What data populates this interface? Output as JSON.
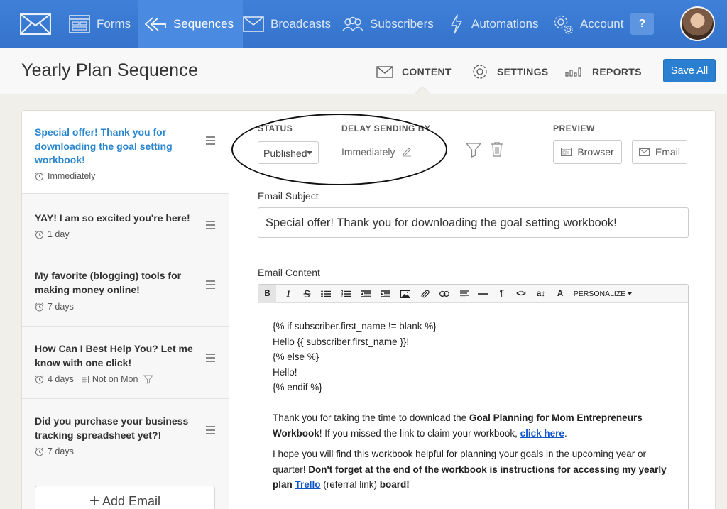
{
  "nav": {
    "items": [
      {
        "label": "Forms",
        "icon": "form-icon"
      },
      {
        "label": "Sequences",
        "icon": "sequence-arrows-icon"
      },
      {
        "label": "Broadcasts",
        "icon": "envelope-icon"
      },
      {
        "label": "Subscribers",
        "icon": "people-icon"
      },
      {
        "label": "Automations",
        "icon": "lightning-icon"
      },
      {
        "label": "Account",
        "icon": "gear-icon"
      }
    ],
    "active": "Sequences",
    "help_label": "?"
  },
  "header": {
    "title": "Yearly Plan Sequence",
    "tabs": [
      {
        "label": "CONTENT",
        "icon": "envelope-icon"
      },
      {
        "label": "SETTINGS",
        "icon": "gear-icon"
      },
      {
        "label": "REPORTS",
        "icon": "bar-chart-icon"
      }
    ],
    "active_tab": "CONTENT",
    "save_label": "Save All"
  },
  "sidebar": {
    "emails": [
      {
        "title": "Special offer! Thank you for downloading the goal setting workbook!",
        "delay": "Immediately",
        "active": true
      },
      {
        "title": "YAY! I am so excited you're here!",
        "delay": "1 day"
      },
      {
        "title": "My favorite (blogging) tools for making money online!",
        "delay": "7 days"
      },
      {
        "title": "How Can I Best Help You? Let me know with one click!",
        "delay": "4 days",
        "schedule": "Not on Mon",
        "has_filter": true
      },
      {
        "title": "Did you purchase your business tracking spreadsheet yet?!",
        "delay": "7 days"
      }
    ],
    "add_label": "Add Email"
  },
  "email": {
    "status_label": "STATUS",
    "status_value": "Published",
    "delay_label": "DELAY SENDING BY",
    "delay_value": "Immediately",
    "preview_label": "PREVIEW",
    "preview_browser": "Browser",
    "preview_email": "Email",
    "subject_label": "Email Subject",
    "subject_value": "Special offer! Thank you for downloading the goal setting workbook!",
    "content_label": "Email Content",
    "toolbar": {
      "bold": "B",
      "italic": "I",
      "personalize": "PERSONALIZE"
    },
    "body": {
      "line1": "{% if subscriber.first_name != blank %}",
      "line2": "Hello {{ subscriber.first_name }}!",
      "line3": "{% else %}",
      "line4": "Hello!",
      "line5": "{% endif %}",
      "p1_a": "Thank you for taking the time to download the ",
      "p1_b": "Goal Planning for Mom Entrepreneurs Workbook",
      "p1_c": "! If you missed the link to claim your workbook, ",
      "p1_link": "click here",
      "p1_d": ".",
      "p2_a": "I hope you will find this workbook helpful for planning your goals in the upcoming year or quarter! ",
      "p2_b": "Don't forget at the end of the workbook is instructions for accessing my yearly plan ",
      "p2_link": "Trello",
      "p2_c": " (referral link) ",
      "p2_d": "board!"
    }
  },
  "colors": {
    "nav_bg": "#3a7bd5",
    "accent": "#2a7fd0",
    "active_title": "#2a87cf"
  }
}
